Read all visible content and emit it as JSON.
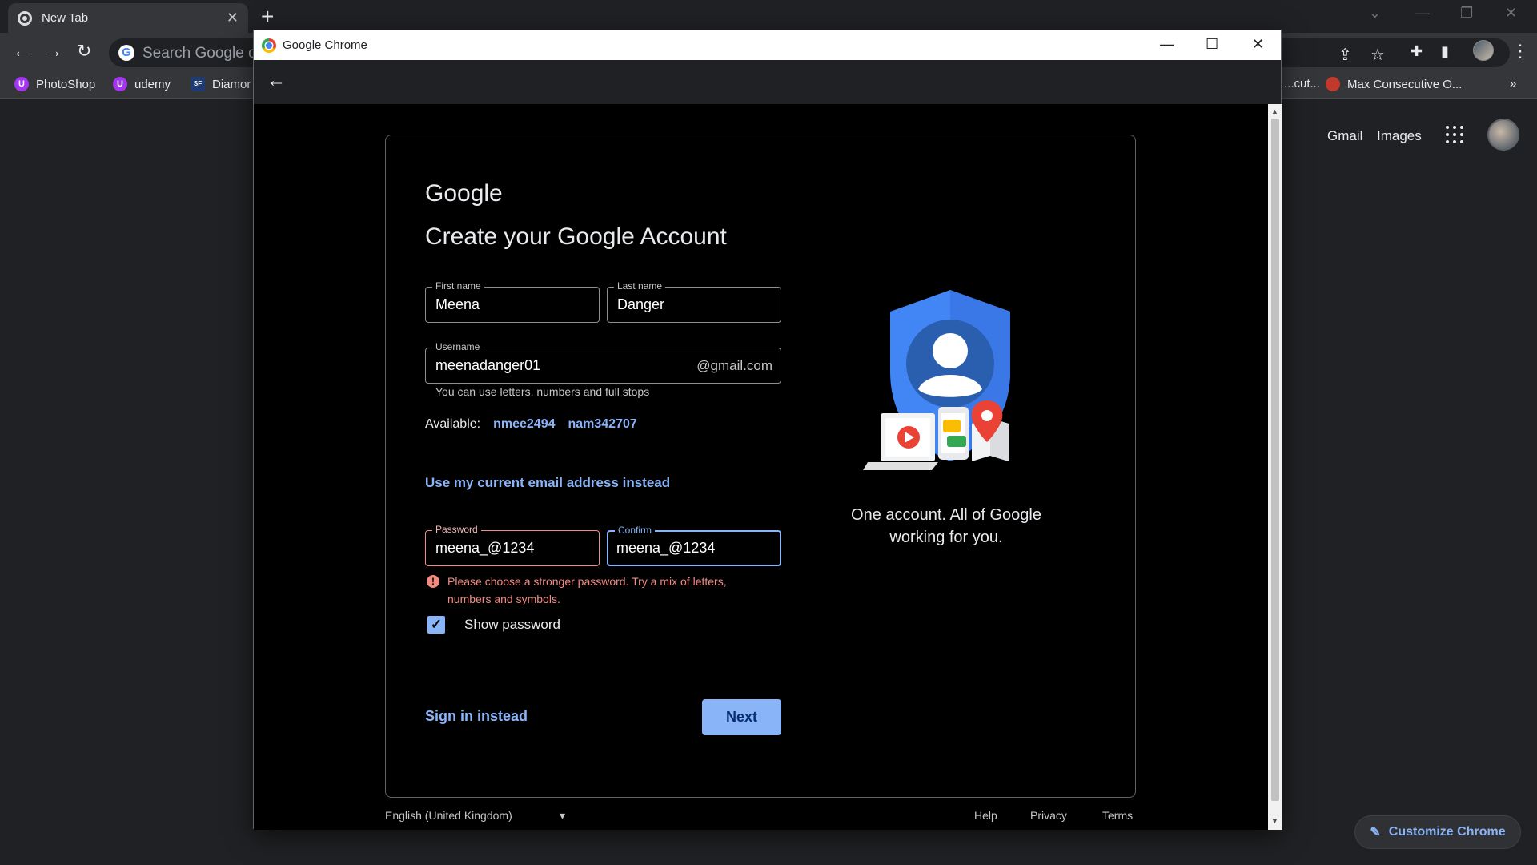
{
  "background_browser": {
    "tab_title": "New Tab",
    "omnibox_placeholder": "Search Google or",
    "bookmarks": [
      {
        "label": "PhotoShop",
        "icon": "udemy-icon"
      },
      {
        "label": "udemy",
        "icon": "udemy-icon"
      },
      {
        "label": "Diamor",
        "icon": "diamond-icon"
      },
      {
        "label": "...cut...",
        "icon": ""
      },
      {
        "label": "Max Consecutive O...",
        "icon": "leetcode-icon"
      }
    ],
    "bookmarks_overflow": "»",
    "ntp_links": [
      "Gmail",
      "Images"
    ],
    "customize_label": "Customize Chrome"
  },
  "popup": {
    "window_title": "Google Chrome",
    "logo_text": "Google",
    "heading": "Create your Google Account",
    "first_name": {
      "label": "First name",
      "value": "Meena"
    },
    "last_name": {
      "label": "Last name",
      "value": "Danger"
    },
    "username": {
      "label": "Username",
      "value": "meenadanger01",
      "suffix": "@gmail.com"
    },
    "username_hint": "You can use letters, numbers and full stops",
    "available_label": "Available:",
    "suggestions": [
      "nmee2494",
      "nam342707"
    ],
    "use_email_link": "Use my current email address instead",
    "password": {
      "label": "Password",
      "value": "meena_@1234"
    },
    "confirm": {
      "label": "Confirm",
      "value": "meena_@1234"
    },
    "error_message": "Please choose a stronger password. Try a mix of letters, numbers and symbols.",
    "show_password_label": "Show password",
    "show_password_checked": true,
    "sign_in_link": "Sign in instead",
    "next_label": "Next",
    "tagline_line1": "One account. All of Google",
    "tagline_line2": "working for you.",
    "footer": {
      "language": "English (United Kingdom)",
      "help": "Help",
      "privacy": "Privacy",
      "terms": "Terms"
    }
  },
  "colors": {
    "accent": "#8ab4f8",
    "error": "#f28b82",
    "shield": "#4285f4"
  }
}
